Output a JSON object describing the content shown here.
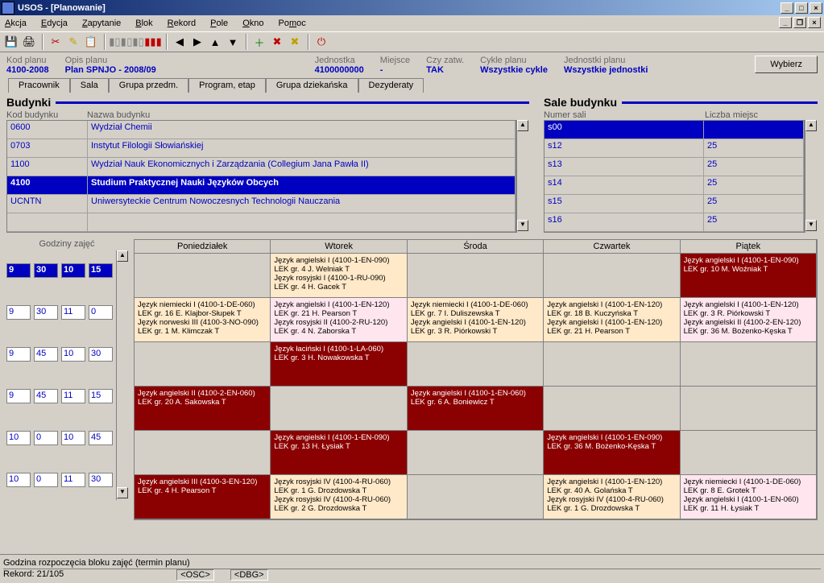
{
  "window": {
    "title": "USOS - [Planowanie]"
  },
  "menu": {
    "akcja": "Akcja",
    "edycja": "Edycja",
    "zapytanie": "Zapytanie",
    "blok": "Blok",
    "rekord": "Rekord",
    "pole": "Pole",
    "okno": "Okno",
    "pomoc": "Pomoc"
  },
  "info": {
    "kod_planu_lbl": "Kod planu",
    "kod_planu": "4100-2008",
    "opis_planu_lbl": "Opis planu",
    "opis_planu": "Plan SPNJO - 2008/09",
    "jednostka_lbl": "Jednostka",
    "jednostka": "4100000000",
    "miejsce_lbl": "Miejsce",
    "miejsce": "-",
    "czy_zatw_lbl": "Czy zatw.",
    "czy_zatw": "TAK",
    "cykle_lbl": "Cykle planu",
    "cykle": "Wszystkie cykle",
    "jednostki_lbl": "Jednostki planu",
    "jednostki": "Wszystkie jednostki",
    "wybierz": "Wybierz"
  },
  "tabs": {
    "t1": "Pracownik",
    "t2": "Sala",
    "t3": "Grupa przedm.",
    "t4": "Program, etap",
    "t5": "Grupa dziekańska",
    "t6": "Dezyderaty"
  },
  "budynki": {
    "title": "Budynki",
    "h1": "Kod budynku",
    "h2": "Nazwa budynku",
    "rows": [
      {
        "k": "0600",
        "n": "Wydział Chemii"
      },
      {
        "k": "0703",
        "n": "Instytut Filologii Słowiańskiej"
      },
      {
        "k": "1100",
        "n": "Wydział Nauk Ekonomicznych i Zarządzania (Collegium Jana Pawła II)"
      },
      {
        "k": "4100",
        "n": "Studium Praktycznej Nauki Języków Obcych"
      },
      {
        "k": "UCNTN",
        "n": "Uniwersyteckie Centrum Nowoczesnych Technologii Nauczania"
      },
      {
        "k": "",
        "n": ""
      }
    ]
  },
  "sale": {
    "title": "Sale budynku",
    "h1": "Numer sali",
    "h2": "Liczba miejsc",
    "rows": [
      {
        "nr": "s00",
        "m": ""
      },
      {
        "nr": "s12",
        "m": "25"
      },
      {
        "nr": "s13",
        "m": "25"
      },
      {
        "nr": "s14",
        "m": "25"
      },
      {
        "nr": "s15",
        "m": "25"
      },
      {
        "nr": "s16",
        "m": "25"
      }
    ]
  },
  "godziny_lbl": "Godziny zajęć",
  "times": [
    {
      "a": "9",
      "b": "30",
      "c": "10",
      "d": "15",
      "sel": true
    },
    {
      "a": "9",
      "b": "30",
      "c": "11",
      "d": "0"
    },
    {
      "a": "9",
      "b": "45",
      "c": "10",
      "d": "30"
    },
    {
      "a": "9",
      "b": "45",
      "c": "11",
      "d": "15"
    },
    {
      "a": "10",
      "b": "0",
      "c": "10",
      "d": "45"
    },
    {
      "a": "10",
      "b": "0",
      "c": "11",
      "d": "30"
    }
  ],
  "days": {
    "d1": "Poniedziałek",
    "d2": "Wtorek",
    "d3": "Środa",
    "d4": "Czwartek",
    "d5": "Piątek"
  },
  "sched": {
    "pon": [
      {
        "cls": "b-grey",
        "lines": []
      },
      {
        "cls": "b-cream",
        "lines": [
          "Język niemiecki I (4100-1-DE-060)",
          "LEK gr. 16 E. Klajbor-Słupek  T",
          "Język norweski III (4100-3-NO-090)",
          "LEK gr. 1 M. Klimczak  T"
        ]
      },
      {
        "cls": "b-grey",
        "lines": []
      },
      {
        "cls": "b-dark",
        "lines": [
          "Język angielski II (4100-2-EN-060)",
          "LEK gr. 20 A. Sakowska  T"
        ]
      },
      {
        "cls": "b-grey",
        "lines": []
      },
      {
        "cls": "b-dark",
        "lines": [
          "Język angielski III (4100-3-EN-120)",
          "LEK gr. 4 H. Pearson  T"
        ]
      }
    ],
    "wto": [
      {
        "cls": "b-cream",
        "lines": [
          "Język angielski I (4100-1-EN-090)",
          "LEK gr. 4 J. Welniak  T",
          "Język rosyjski I (4100-1-RU-090)",
          "LEK gr. 4 H. Gacek  T"
        ]
      },
      {
        "cls": "b-pink",
        "lines": [
          "Język angielski I (4100-1-EN-120)",
          "LEK gr. 21 H. Pearson  T",
          "Język rosyjski II (4100-2-RU-120)",
          "LEK gr. 4 N. Zaborska  T"
        ]
      },
      {
        "cls": "b-dark",
        "lines": [
          "Język łaciński I (4100-1-LA-060)",
          "LEK gr. 3 H. Nowakowska  T"
        ]
      },
      {
        "cls": "b-grey",
        "lines": []
      },
      {
        "cls": "b-dark",
        "lines": [
          "Język angielski I (4100-1-EN-090)",
          "LEK gr. 13 H. Łysiak  T"
        ]
      },
      {
        "cls": "b-cream",
        "lines": [
          "Język rosyjski IV (4100-4-RU-060)",
          "LEK gr. 1 G. Drozdowska  T",
          "Język rosyjski IV (4100-4-RU-060)",
          "LEK gr. 2 G. Drozdowska  T"
        ]
      }
    ],
    "sro": [
      {
        "cls": "b-grey",
        "lines": []
      },
      {
        "cls": "b-cream",
        "lines": [
          "Język niemiecki I (4100-1-DE-060)",
          "LEK gr. 7 I. Duliszewska  T",
          "Język angielski I (4100-1-EN-120)",
          "LEK gr. 3 R. Piórkowski  T"
        ]
      },
      {
        "cls": "b-grey",
        "lines": []
      },
      {
        "cls": "b-dark",
        "lines": [
          "Język angielski I (4100-1-EN-060)",
          "LEK gr. 6 A. Boniewicz  T"
        ]
      },
      {
        "cls": "b-grey",
        "lines": []
      },
      {
        "cls": "b-grey",
        "lines": []
      }
    ],
    "czw": [
      {
        "cls": "b-grey",
        "lines": []
      },
      {
        "cls": "b-cream",
        "lines": [
          "Język angielski I (4100-1-EN-120)",
          "LEK gr. 18 B. Kuczyńska  T",
          "Język angielski I (4100-1-EN-120)",
          "LEK gr. 21 H. Pearson  T"
        ]
      },
      {
        "cls": "b-grey",
        "lines": []
      },
      {
        "cls": "b-grey",
        "lines": []
      },
      {
        "cls": "b-dark",
        "lines": [
          "Język angielski I (4100-1-EN-090)",
          "LEK gr. 36 M. Bożenko-Kęska  T"
        ]
      },
      {
        "cls": "b-cream",
        "lines": [
          "Język angielski I (4100-1-EN-120)",
          "LEK gr. 40 A. Golańska  T",
          "Język rosyjski IV (4100-4-RU-060)",
          "LEK gr. 1 G. Drozdowska  T"
        ]
      }
    ],
    "pia": [
      {
        "cls": "b-dark",
        "lines": [
          "Język angielski I (4100-1-EN-090)",
          "LEK gr. 10 M. Woźniak  T"
        ]
      },
      {
        "cls": "b-pink",
        "lines": [
          "Język angielski I (4100-1-EN-120)",
          "LEK gr. 3 R. Piórkowski  T",
          "Język angielski II (4100-2-EN-120)",
          "LEK gr. 36 M. Bożenko-Kęska  T"
        ]
      },
      {
        "cls": "b-grey",
        "lines": []
      },
      {
        "cls": "b-grey",
        "lines": []
      },
      {
        "cls": "b-grey",
        "lines": []
      },
      {
        "cls": "b-pink",
        "lines": [
          "Język niemiecki I (4100-1-DE-060)",
          "LEK gr. 8 E. Grotek  T",
          "Język angielski I (4100-1-EN-060)",
          "LEK gr. 11 H. Łysiak  T"
        ]
      }
    ]
  },
  "status": {
    "line1": "Godzina rozpoczęcia bloku zajęć (termin planu)",
    "rekord": "Rekord: 21/105",
    "osc": "<OSC>",
    "dbg": "<DBG>"
  }
}
